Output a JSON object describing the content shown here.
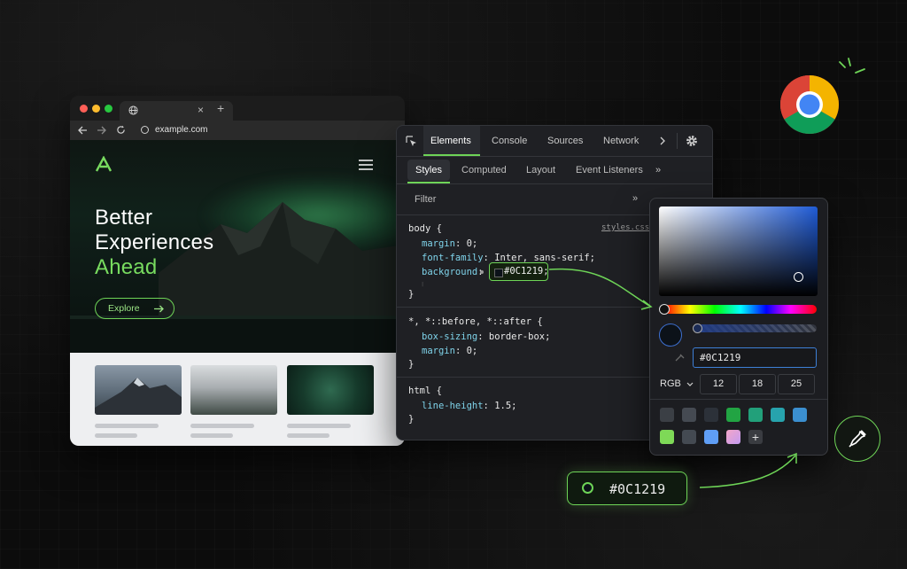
{
  "browser": {
    "address": "example.com",
    "hero_title_line1": "Better",
    "hero_title_line2": "Experiences",
    "hero_title_line3": "Ahead",
    "cta_label": "Explore",
    "new_tab_symbol": "+",
    "close_tab_symbol": "×"
  },
  "devtools": {
    "tabs": [
      "Elements",
      "Console",
      "Sources",
      "Network"
    ],
    "subtabs": [
      "Styles",
      "Computed",
      "Layout",
      "Event Listeners"
    ],
    "more_symbol": "»",
    "filter_label": "Filter",
    "stylesheet_link": "styles.css:1",
    "rules": {
      "body_selector": "body {",
      "body_margin_prop": "margin",
      "body_margin_val": " 0;",
      "body_font_prop": "font-family",
      "body_font_val": " Inter, sans-serif;",
      "body_bg_prop": "background",
      "body_bg_val": "#0C1219;",
      "close": "}",
      "universal_selector": "*, *::before, *::after {",
      "boxsizing_prop": "box-sizing",
      "boxsizing_val": " border-box;",
      "margin_prop": "margin",
      "margin_val": " 0;",
      "html_selector": "html {",
      "lineheight_prop": "line-height",
      "lineheight_val": " 1.5;"
    }
  },
  "picker": {
    "hex_value": "#0C1219",
    "mode_label": "RGB",
    "r": "12",
    "g": "18",
    "b": "25",
    "add_symbol": "+",
    "swatches_row1": [
      "#3b3f45",
      "#454a52",
      "#2c3139",
      "#22a443",
      "#22a07a",
      "#27a3ad",
      "#3b8fd0"
    ],
    "swatches_row2": [
      "#7ed957",
      "#444a52",
      "#5f9ef5",
      "gradient"
    ]
  },
  "callout": {
    "hex_value": "#0C1219"
  },
  "colors": {
    "accent_green": "#6ed457",
    "selected_color": "#0C1219",
    "devtools_bg": "#1f2024",
    "property_blue": "#7fd3ea"
  },
  "icons": [
    "chrome-logo-icon",
    "eyedropper-icon",
    "gear-icon",
    "inspect-icon",
    "globe-icon",
    "hamburger-menu-icon",
    "brand-logo-icon",
    "arrow-right-icon"
  ]
}
